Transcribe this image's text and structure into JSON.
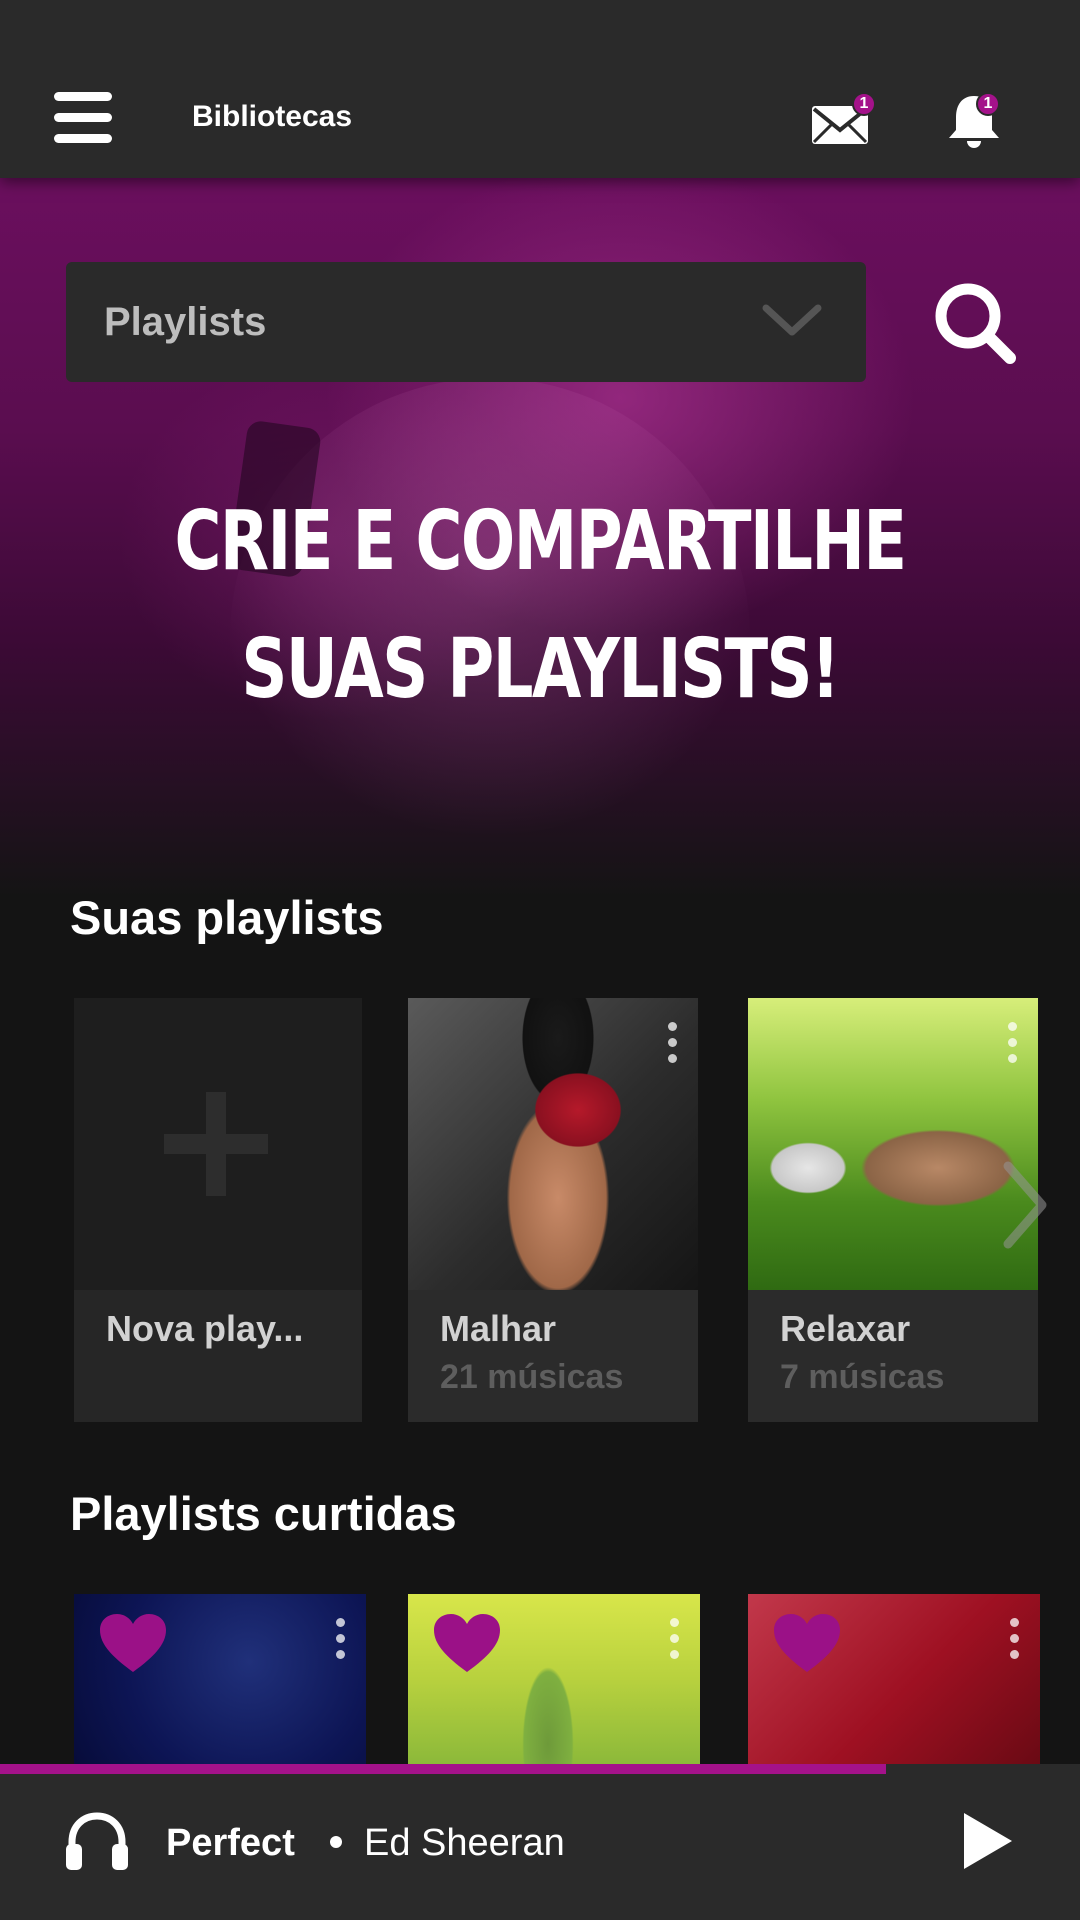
{
  "appbar": {
    "title": "Bibliotecas",
    "mail_badge": "1",
    "bell_badge": "1"
  },
  "hero": {
    "dropdown_value": "Playlists",
    "headline_line1": "Crie e compartilhe",
    "headline_line2": "suas playlists!"
  },
  "your_playlists": {
    "title": "Suas playlists",
    "items": [
      {
        "name": "Nova play...",
        "count": ""
      },
      {
        "name": "Malhar",
        "count": "21 músicas"
      },
      {
        "name": "Relaxar",
        "count": "7 músicas"
      }
    ]
  },
  "liked_playlists": {
    "title": "Playlists curtidas"
  },
  "player": {
    "title": "Perfect",
    "artist": "Ed Sheeran",
    "progress": 0.82
  },
  "colors": {
    "accent": "#a4128a",
    "bar_bg": "#2a2a2a",
    "page_bg": "#141414"
  },
  "icons": [
    "menu-icon",
    "mail-icon",
    "bell-icon",
    "search-icon",
    "chevron-down-icon",
    "plus-icon",
    "more-vert-icon",
    "chevron-right-icon",
    "heart-icon",
    "headphones-icon",
    "play-icon"
  ]
}
